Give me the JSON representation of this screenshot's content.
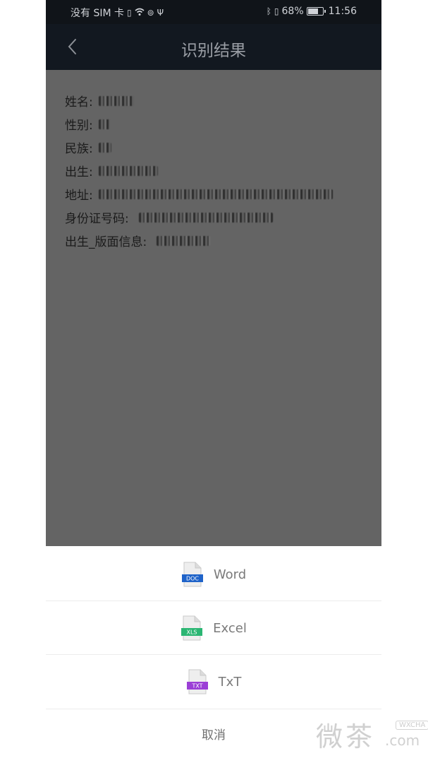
{
  "status_bar": {
    "carrier": "没有 SIM 卡",
    "battery_percent": "68%",
    "time": "11:56"
  },
  "nav": {
    "title": "识别结果"
  },
  "fields": [
    {
      "label": "姓名:"
    },
    {
      "label": "性别:"
    },
    {
      "label": "民族:"
    },
    {
      "label": "出生:"
    },
    {
      "label": "地址:"
    },
    {
      "label": "身份证号码:"
    },
    {
      "label": "出生_版面信息:"
    }
  ],
  "sheet": {
    "options": [
      {
        "label": "Word",
        "badge": "DOC",
        "color": "#1f63c9",
        "icon": "doc-file-icon"
      },
      {
        "label": "Excel",
        "badge": "XLS",
        "color": "#2bb673",
        "icon": "xls-file-icon"
      },
      {
        "label": "TxT",
        "badge": "TXT",
        "color": "#9b3fd6",
        "icon": "txt-file-icon"
      }
    ],
    "cancel": "取消"
  },
  "watermark": {
    "big": "微茶",
    "tag": "WXCHA",
    "domain": ".com"
  }
}
